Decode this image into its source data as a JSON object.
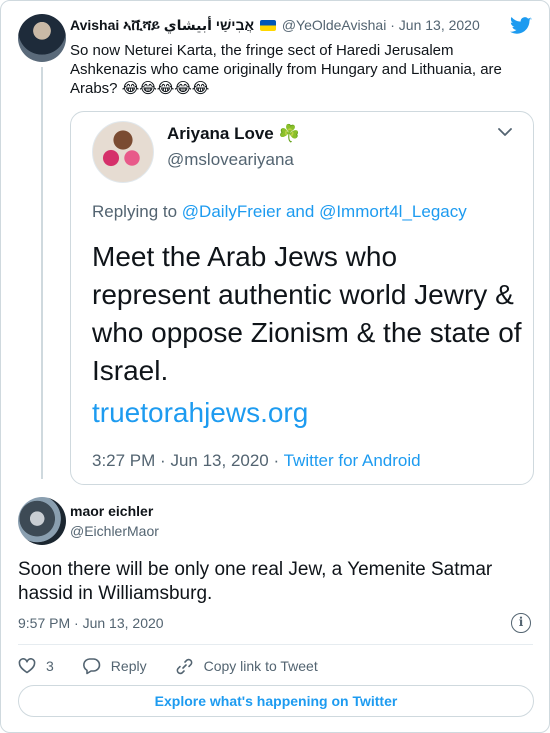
{
  "parent_tweet": {
    "author_name": "Avishai ኣቪሻይ אֲבִישַׁי أبيشاي",
    "flag_icon": "ukraine-flag-icon",
    "handle": "@YeOldeAvishai",
    "date": "Jun 13, 2020",
    "separator": "·",
    "text": "So now Neturei Karta, the fringe sect of Haredi Jerusalem Ashkenazis who came originally from Hungary and Lithuania, are Arabs? 😂😂😂😂😂"
  },
  "quoted_tweet": {
    "author_name": "Ariyana Love",
    "clover": "☘️",
    "handle": "@msloveariyana",
    "replying_prefix": "Replying to",
    "replying_user_1": "@DailyFreier",
    "replying_and": "and",
    "replying_user_2": "@Immort4l_Legacy",
    "text": "Meet the Arab Jews who represent authentic world Jewry & who oppose Zionism & the state of Israel.",
    "link": "truetorahjews.org",
    "time": "3:27 PM",
    "separator": "·",
    "date": "Jun 13, 2020",
    "source": "Twitter for Android"
  },
  "reply_tweet": {
    "author_name": "maor eichler",
    "handle": "@EichlerMaor",
    "text": "Soon there will be only one real Jew, a Yemenite Satmar hassid in Williamsburg.",
    "time": "9:57 PM",
    "separator": "·",
    "date": "Jun 13, 2020",
    "info": "i"
  },
  "actions": {
    "like_count": "3",
    "reply_label": "Reply",
    "copy_link_label": "Copy link to Tweet"
  },
  "explore_label": "Explore what's happening on Twitter",
  "colors": {
    "accent": "#1d9bf0",
    "text": "#0f1419",
    "muted": "#536471",
    "border": "#cfd9de"
  }
}
